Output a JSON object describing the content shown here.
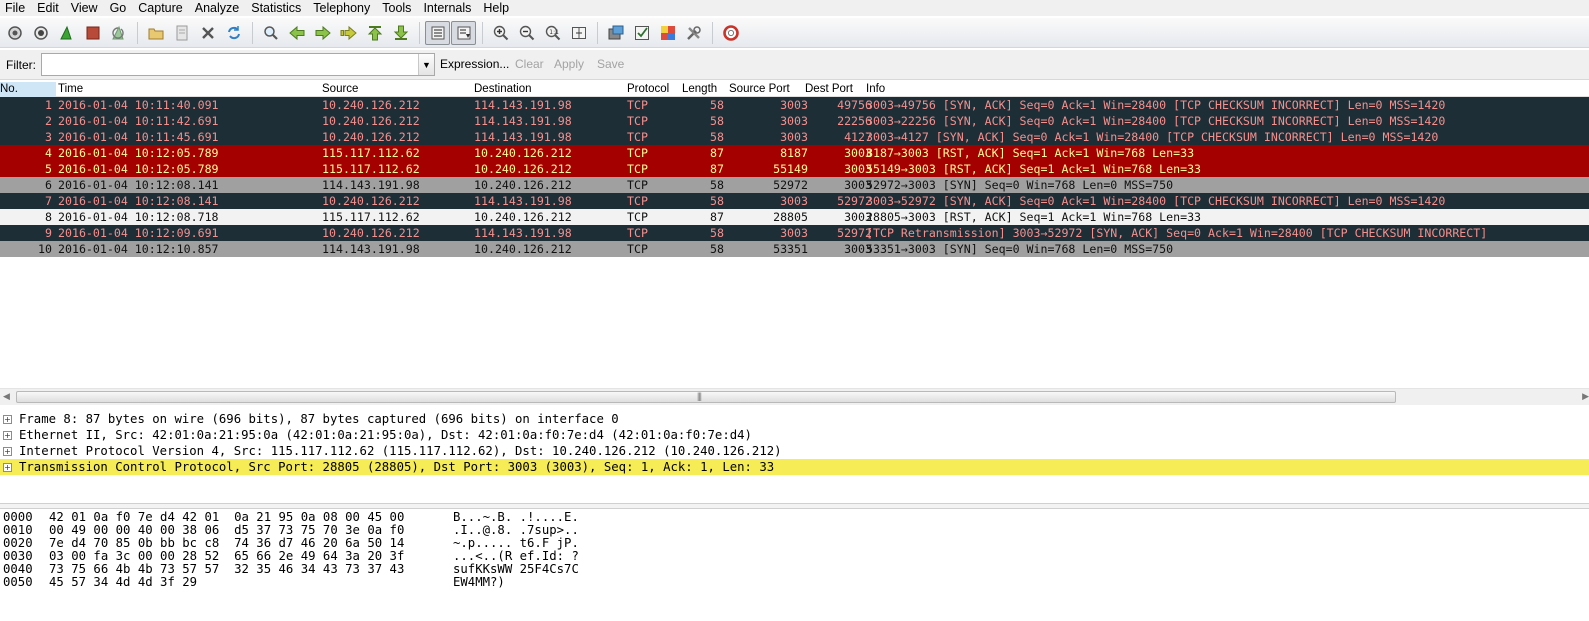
{
  "menu": [
    "File",
    "Edit",
    "View",
    "Go",
    "Capture",
    "Analyze",
    "Statistics",
    "Telephony",
    "Tools",
    "Internals",
    "Help"
  ],
  "toolbar": {
    "icons": [
      "interface-list-icon",
      "capture-options-icon",
      "start-capture-icon",
      "stop-capture-icon",
      "restart-capture-icon",
      "open-file-icon",
      "save-file-icon",
      "close-file-icon",
      "reload-icon",
      "find-packet-icon",
      "go-back-icon",
      "go-forward-icon",
      "go-to-packet-icon",
      "go-first-icon",
      "go-last-icon",
      "colorize-icon",
      "auto-scroll-icon",
      "zoom-in-icon",
      "zoom-out-icon",
      "zoom-normal-icon",
      "resize-columns-icon",
      "capture-filters-icon",
      "display-filters-icon",
      "coloring-rules-icon",
      "preferences-icon",
      "help-icon"
    ]
  },
  "filter": {
    "label": "Filter:",
    "value": "",
    "expression": "Expression...",
    "clear": "Clear",
    "apply": "Apply",
    "save": "Save"
  },
  "columns": [
    "No.",
    "Time",
    "Source",
    "Destination",
    "Protocol",
    "Length",
    "Source Port",
    "Dest Port",
    "Info"
  ],
  "packets": [
    {
      "no": "1",
      "time": "2016-01-04 10:11:40.091",
      "src": "10.240.126.212",
      "dst": "114.143.191.98",
      "proto": "TCP",
      "len": "58",
      "sport": "3003",
      "dport": "49756",
      "info": "3003→49756 [SYN, ACK] Seq=0 Ack=1 Win=28400 [TCP CHECKSUM INCORRECT] Len=0 MSS=1420",
      "bg": "#1e2e36",
      "fg": "#f4908e"
    },
    {
      "no": "2",
      "time": "2016-01-04 10:11:42.691",
      "src": "10.240.126.212",
      "dst": "114.143.191.98",
      "proto": "TCP",
      "len": "58",
      "sport": "3003",
      "dport": "22256",
      "info": "3003→22256 [SYN, ACK] Seq=0 Ack=1 Win=28400 [TCP CHECKSUM INCORRECT] Len=0 MSS=1420",
      "bg": "#1e2e36",
      "fg": "#f4908e"
    },
    {
      "no": "3",
      "time": "2016-01-04 10:11:45.691",
      "src": "10.240.126.212",
      "dst": "114.143.191.98",
      "proto": "TCP",
      "len": "58",
      "sport": "3003",
      "dport": "4127",
      "info": "3003→4127 [SYN, ACK] Seq=0 Ack=1 Win=28400 [TCP CHECKSUM INCORRECT] Len=0 MSS=1420",
      "bg": "#1e2e36",
      "fg": "#f4908e"
    },
    {
      "no": "4",
      "time": "2016-01-04 10:12:05.789",
      "src": "115.117.112.62",
      "dst": "10.240.126.212",
      "proto": "TCP",
      "len": "87",
      "sport": "8187",
      "dport": "3003",
      "info": "8187→3003 [RST, ACK] Seq=1 Ack=1 Win=768 Len=33",
      "bg": "#a40000",
      "fg": "#fffb9a"
    },
    {
      "no": "5",
      "time": "2016-01-04 10:12:05.789",
      "src": "115.117.112.62",
      "dst": "10.240.126.212",
      "proto": "TCP",
      "len": "87",
      "sport": "55149",
      "dport": "3003",
      "info": "55149→3003 [RST, ACK] Seq=1 Ack=1 Win=768 Len=33",
      "bg": "#a40000",
      "fg": "#fffb9a"
    },
    {
      "no": "6",
      "time": "2016-01-04 10:12:08.141",
      "src": "114.143.191.98",
      "dst": "10.240.126.212",
      "proto": "TCP",
      "len": "58",
      "sport": "52972",
      "dport": "3003",
      "info": "52972→3003 [SYN] Seq=0 Win=768 Len=0 MSS=750",
      "bg": "#a0a0a0",
      "fg": "#111111"
    },
    {
      "no": "7",
      "time": "2016-01-04 10:12:08.141",
      "src": "10.240.126.212",
      "dst": "114.143.191.98",
      "proto": "TCP",
      "len": "58",
      "sport": "3003",
      "dport": "52972",
      "info": "3003→52972 [SYN, ACK] Seq=0 Ack=1 Win=28400 [TCP CHECKSUM INCORRECT] Len=0 MSS=1420",
      "bg": "#1e2e36",
      "fg": "#f4908e"
    },
    {
      "no": "8",
      "time": "2016-01-04 10:12:08.718",
      "src": "115.117.112.62",
      "dst": "10.240.126.212",
      "proto": "TCP",
      "len": "87",
      "sport": "28805",
      "dport": "3003",
      "info": "28805→3003 [RST, ACK] Seq=1 Ack=1 Win=768 Len=33",
      "bg": "#f2f2f2",
      "fg": "#111111"
    },
    {
      "no": "9",
      "time": "2016-01-04 10:12:09.691",
      "src": "10.240.126.212",
      "dst": "114.143.191.98",
      "proto": "TCP",
      "len": "58",
      "sport": "3003",
      "dport": "52972",
      "info": "[TCP Retransmission] 3003→52972 [SYN, ACK] Seq=0 Ack=1 Win=28400 [TCP CHECKSUM INCORRECT]",
      "bg": "#1e2e36",
      "fg": "#f4908e"
    },
    {
      "no": "10",
      "time": "2016-01-04 10:12:10.857",
      "src": "114.143.191.98",
      "dst": "10.240.126.212",
      "proto": "TCP",
      "len": "58",
      "sport": "53351",
      "dport": "3003",
      "info": "53351→3003 [SYN] Seq=0 Win=768 Len=0 MSS=750",
      "bg": "#a0a0a0",
      "fg": "#111111"
    }
  ],
  "details": [
    {
      "text": "Frame 8: 87 bytes on wire (696 bits), 87 bytes captured (696 bits) on interface 0",
      "selected": false
    },
    {
      "text": "Ethernet II, Src: 42:01:0a:21:95:0a (42:01:0a:21:95:0a), Dst: 42:01:0a:f0:7e:d4 (42:01:0a:f0:7e:d4)",
      "selected": false
    },
    {
      "text": "Internet Protocol Version 4, Src: 115.117.112.62 (115.117.112.62), Dst: 10.240.126.212 (10.240.126.212)",
      "selected": false
    },
    {
      "text": "Transmission Control Protocol, Src Port: 28805 (28805), Dst Port: 3003 (3003), Seq: 1, Ack: 1, Len: 33",
      "selected": true
    }
  ],
  "hex": [
    {
      "offset": "0000",
      "bytes": "42 01 0a f0 7e d4 42 01  0a 21 95 0a 08 00 45 00",
      "ascii": "B...~.B. .!....E."
    },
    {
      "offset": "0010",
      "bytes": "00 49 00 00 40 00 38 06  d5 37 73 75 70 3e 0a f0",
      "ascii": ".I..@.8. .7sup>.."
    },
    {
      "offset": "0020",
      "bytes": "7e d4 70 85 0b bb bc c8  74 36 d7 46 20 6a 50 14",
      "ascii": "~.p..... t6.F jP."
    },
    {
      "offset": "0030",
      "bytes": "03 00 fa 3c 00 00 28 52  65 66 2e 49 64 3a 20 3f",
      "ascii": "...<..(R ef.Id: ?"
    },
    {
      "offset": "0040",
      "bytes": "73 75 66 4b 4b 73 57 57  32 35 46 34 43 73 37 43",
      "ascii": "sufKKsWW 25F4Cs7C"
    },
    {
      "offset": "0050",
      "bytes": "45 57 34 4d 4d 3f 29",
      "ascii": "EW4MM?)"
    }
  ]
}
